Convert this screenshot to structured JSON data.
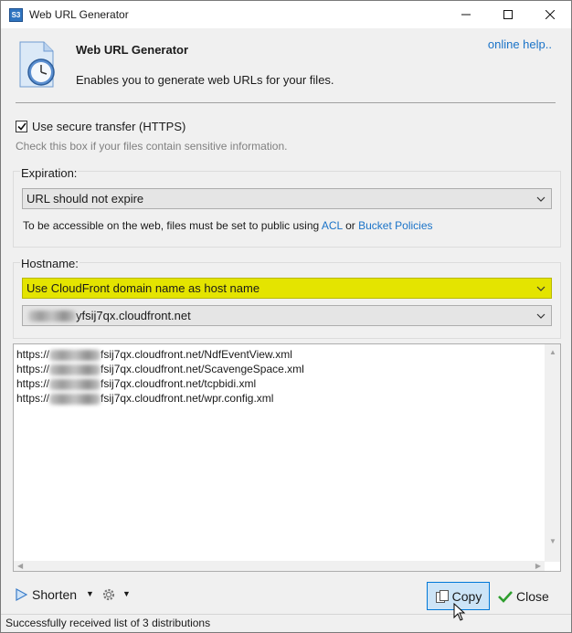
{
  "window": {
    "title": "Web URL Generator",
    "app_icon": "S3"
  },
  "header": {
    "title": "Web URL Generator",
    "description": "Enables you to generate web URLs for your files.",
    "help_link": "online help.."
  },
  "secure": {
    "checked": true,
    "label": "Use secure transfer (HTTPS)",
    "hint": "Check this box if your files contain sensitive information."
  },
  "expiration": {
    "label": "Expiration:",
    "selected": "URL should not expire",
    "note_prefix": "To be accessible on the web, files must be set to public using",
    "link_acl": "ACL",
    "note_or": "or",
    "link_policies": "Bucket Policies"
  },
  "hostname": {
    "label": "Hostname:",
    "mode_selected": "Use CloudFront domain name as host name",
    "domain_selected_suffix": "yfsij7qx.cloudfront.net"
  },
  "urls": [
    {
      "prefix": "https://",
      "suffix": "fsij7qx.cloudfront.net/NdfEventView.xml"
    },
    {
      "prefix": "https://",
      "suffix": "fsij7qx.cloudfront.net/ScavengeSpace.xml"
    },
    {
      "prefix": "https://",
      "suffix": "fsij7qx.cloudfront.net/tcpbidi.xml"
    },
    {
      "prefix": "https://",
      "suffix": "fsij7qx.cloudfront.net/wpr.config.xml"
    }
  ],
  "toolbar": {
    "shorten_label": "Shorten",
    "copy_label": "Copy",
    "close_label": "Close"
  },
  "status": {
    "text": "Successfully received list of 3 distributions"
  },
  "colors": {
    "highlight_select": "#e4e400",
    "link": "#1a73c8",
    "copy_button": "#cce4f7"
  }
}
